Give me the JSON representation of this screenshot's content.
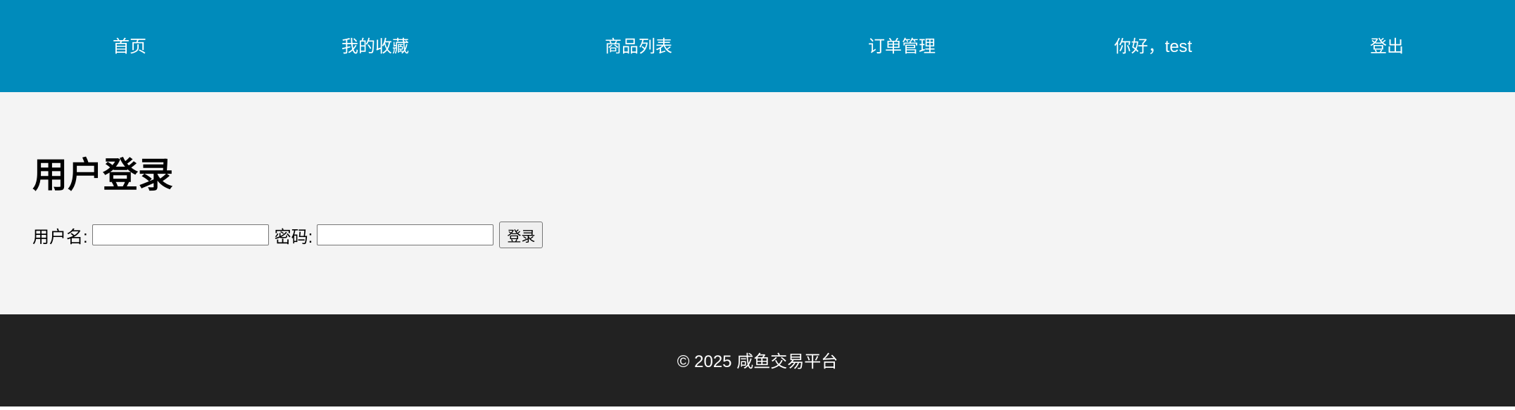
{
  "nav": {
    "items": [
      {
        "label": "首页"
      },
      {
        "label": "我的收藏"
      },
      {
        "label": "商品列表"
      },
      {
        "label": "订单管理"
      },
      {
        "label": "你好，test"
      },
      {
        "label": "登出"
      }
    ]
  },
  "main": {
    "title": "用户登录",
    "form": {
      "username_label": "用户名:",
      "username_value": "",
      "password_label": "密码:",
      "password_value": "",
      "submit_label": "登录"
    }
  },
  "footer": {
    "copyright": "© 2025 咸鱼交易平台"
  },
  "colors": {
    "nav_bg": "#008bbb",
    "main_bg": "#f4f4f4",
    "footer_bg": "#222222"
  }
}
